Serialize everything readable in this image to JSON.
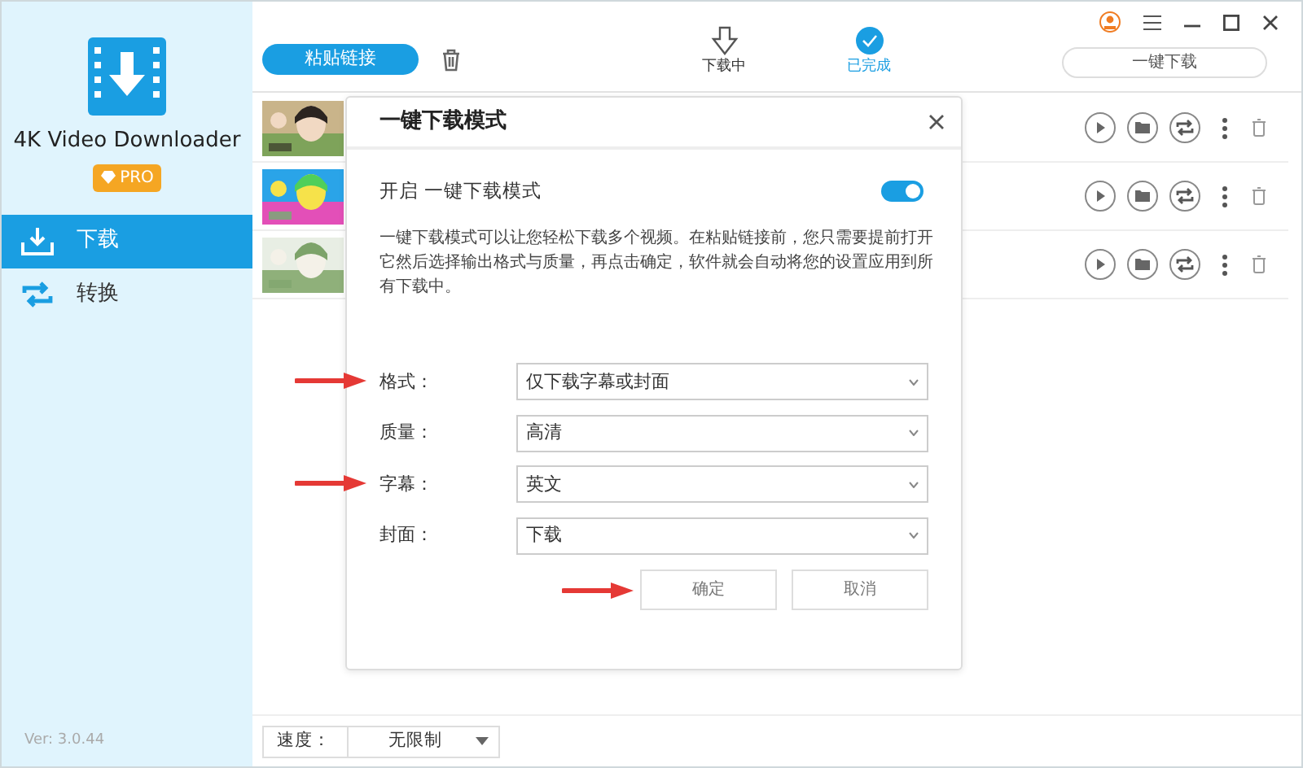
{
  "app": {
    "name": "4K Video Downloader",
    "badge": "PRO",
    "version": "Ver: 3.0.44"
  },
  "sidebar": {
    "items": [
      {
        "label": "下载",
        "selected": true
      },
      {
        "label": "转换",
        "selected": false
      }
    ]
  },
  "toolbar": {
    "paste_button": "粘贴链接",
    "smart_mode_button": "一键下载",
    "tabs": [
      {
        "label": "下载中",
        "selected": false
      },
      {
        "label": "已完成",
        "selected": true
      }
    ]
  },
  "dialog": {
    "title": "一键下载模式",
    "toggle": {
      "label": "开启 一键下载模式",
      "on": true
    },
    "description": "一键下载模式可以让您轻松下载多个视频。在粘贴链接前，您只需要提前打开它然后选择输出格式与质量，再点击确定，软件就会自动将您的设置应用到所有下载中。",
    "fields": [
      {
        "label": "格式：",
        "value": "仅下载字幕或封面",
        "arrow": true
      },
      {
        "label": "质量：",
        "value": "高清",
        "arrow": false
      },
      {
        "label": "字幕：",
        "value": "英文",
        "arrow": true
      },
      {
        "label": "封面：",
        "value": "下载",
        "arrow": false
      }
    ],
    "buttons": [
      {
        "label": "确定",
        "arrow": true
      },
      {
        "label": "取消",
        "arrow": false
      }
    ]
  },
  "speed": {
    "label": "速度：",
    "value": "无限制"
  }
}
